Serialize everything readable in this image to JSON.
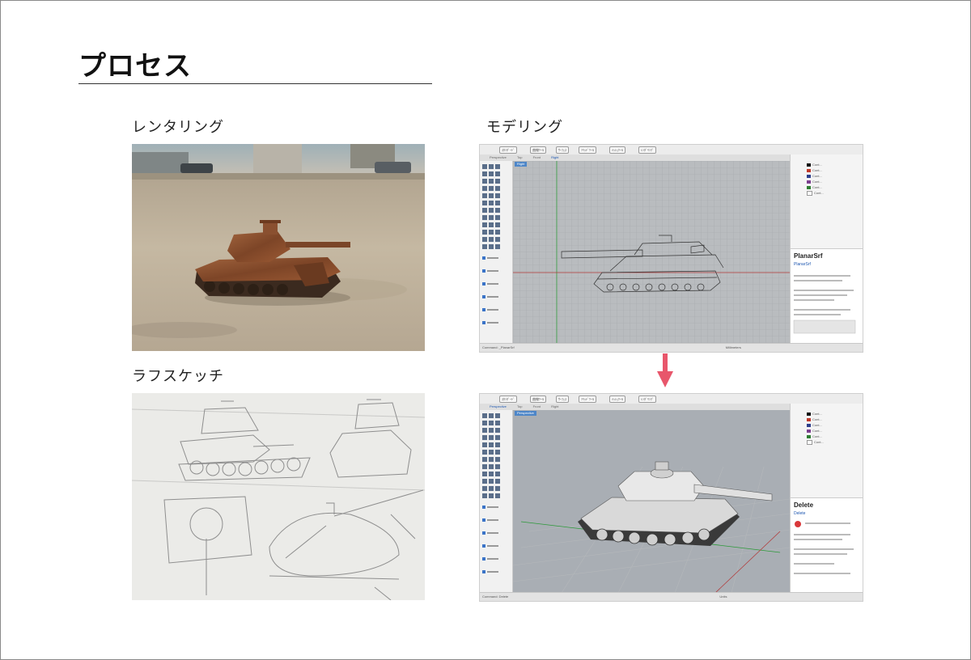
{
  "heading": "プロセス",
  "sections": {
    "rendering": "レンタリング",
    "modeling": "モデリング",
    "rough_sketch": "ラフスケッチ"
  },
  "rhino_top": {
    "toolbar_chips": [
      "ｽﾀﾝﾀﾞｰﾄﾞ",
      "曲線ﾂｰﾙ",
      "ｻｰﾌｪｽ",
      "ｿﾘｯﾄﾞﾂｰﾙ",
      "ﾒｯｼｭﾂｰﾙ",
      "ﾚﾝﾀﾞﾘﾝｸﾞ"
    ],
    "view_tabs": [
      "Perspective",
      "Top",
      "Front",
      "Right"
    ],
    "active_viewport": "Right",
    "help_title": "PlanarSrf",
    "help_command": "PlanarSrf",
    "command_line": "Command: _PlanarSrf",
    "units": "Millimeters"
  },
  "rhino_bottom": {
    "toolbar_chips": [
      "ｽﾀﾝﾀﾞｰﾄﾞ",
      "曲線ﾂｰﾙ",
      "ｻｰﾌｪｽ",
      "ｿﾘｯﾄﾞﾂｰﾙ",
      "ﾒｯｼｭﾂｰﾙ",
      "ﾚﾝﾀﾞﾘﾝｸﾞ"
    ],
    "view_tabs": [
      "Perspective",
      "Top",
      "Front",
      "Right"
    ],
    "active_viewport": "Perspective",
    "help_title": "Delete",
    "help_command": "Delete",
    "command_line": "Command: Delete",
    "units": "Units"
  },
  "layers": [
    {
      "name": "Cont...",
      "color": "#111111"
    },
    {
      "name": "Cont...",
      "color": "#c0392b"
    },
    {
      "name": "Cont...",
      "color": "#2c3e8c"
    },
    {
      "name": "Cont...",
      "color": "#7b3f8f"
    },
    {
      "name": "Cont...",
      "color": "#2e7d32"
    },
    {
      "name": "Cont...",
      "color": "#ffffff"
    }
  ],
  "colors": {
    "arrow": "#e8566b",
    "viewport_grid_bg": "#b9bcbf",
    "viewport_3d_bg": "#a9aeb4",
    "accent_blue": "#1c56b0"
  }
}
